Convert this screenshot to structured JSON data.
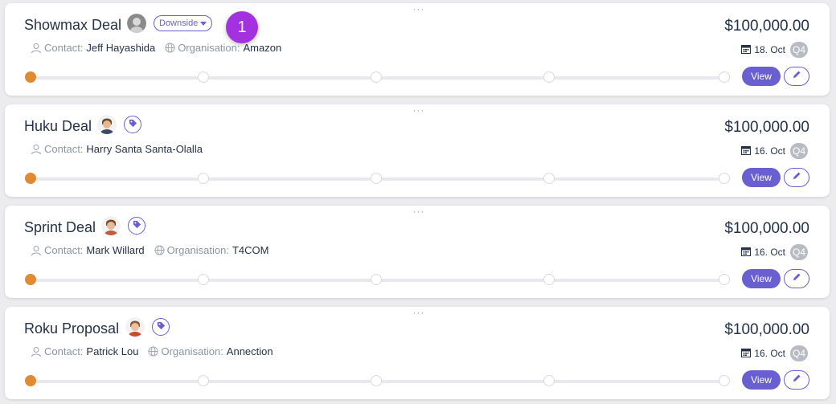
{
  "deals": [
    {
      "title": "Showmax Deal",
      "tag_label": "Downside",
      "contact_label": "Contact:",
      "contact": "Jeff Hayashida",
      "org_label": "Organisation:",
      "organisation": "Amazon",
      "amount": "$100,000.00",
      "date": "18. Oct",
      "quarter": "Q4",
      "view_label": "View",
      "active_step": 0
    },
    {
      "title": "Huku Deal",
      "contact_label": "Contact:",
      "contact": "Harry Santa Santa-Olalla",
      "amount": "$100,000.00",
      "date": "16. Oct",
      "quarter": "Q4",
      "view_label": "View",
      "active_step": 0
    },
    {
      "title": "Sprint Deal",
      "contact_label": "Contact:",
      "contact": "Mark Willard",
      "org_label": "Organisation:",
      "organisation": "T4COM",
      "amount": "$100,000.00",
      "date": "16. Oct",
      "quarter": "Q4",
      "view_label": "View",
      "active_step": 0
    },
    {
      "title": "Roku Proposal",
      "contact_label": "Contact:",
      "contact": "Patrick Lou",
      "org_label": "Organisation:",
      "organisation": "Annection",
      "amount": "$100,000.00",
      "date": "16. Oct",
      "quarter": "Q4",
      "view_label": "View",
      "active_step": 0
    }
  ],
  "notification_badge": "1",
  "colors": {
    "accent": "#6a5fd0",
    "active_step": "#e08a32",
    "badge": "#a331e0"
  }
}
